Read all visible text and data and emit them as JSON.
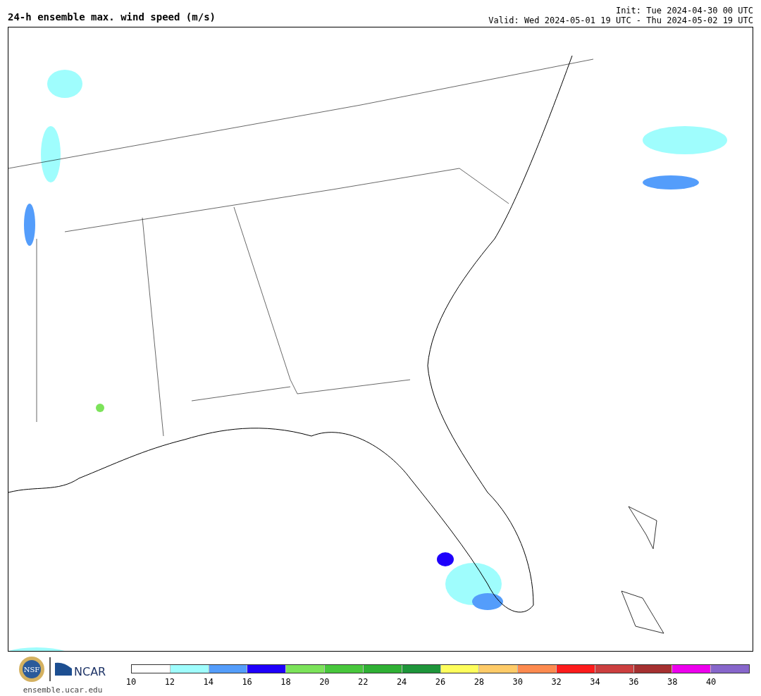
{
  "title": "24-h ensemble max. wind speed (m/s)",
  "init": "Init: Tue 2024-04-30 00 UTC",
  "valid": "Valid: Wed 2024-05-01 19 UTC - Thu 2024-05-02 19 UTC",
  "logos": {
    "nsf": "NSF",
    "ncar": "NCAR",
    "site": "ensemble.ucar.edu"
  },
  "colorbar": {
    "segments": [
      {
        "color": "#ffffff"
      },
      {
        "color": "#9ffdfd"
      },
      {
        "color": "#549dfb"
      },
      {
        "color": "#1f00fb"
      },
      {
        "color": "#7ce35a"
      },
      {
        "color": "#48c73c"
      },
      {
        "color": "#2fb034"
      },
      {
        "color": "#1e953a"
      },
      {
        "color": "#fefe5c"
      },
      {
        "color": "#fecb68"
      },
      {
        "color": "#fd8a4f"
      },
      {
        "color": "#fd1c1c"
      },
      {
        "color": "#cc3f3f"
      },
      {
        "color": "#a53030"
      },
      {
        "color": "#ed00ed"
      },
      {
        "color": "#8766cb"
      }
    ],
    "ticks": [
      "10",
      "12",
      "14",
      "16",
      "18",
      "20",
      "22",
      "24",
      "26",
      "28",
      "30",
      "32",
      "34",
      "36",
      "38",
      "40"
    ]
  }
}
